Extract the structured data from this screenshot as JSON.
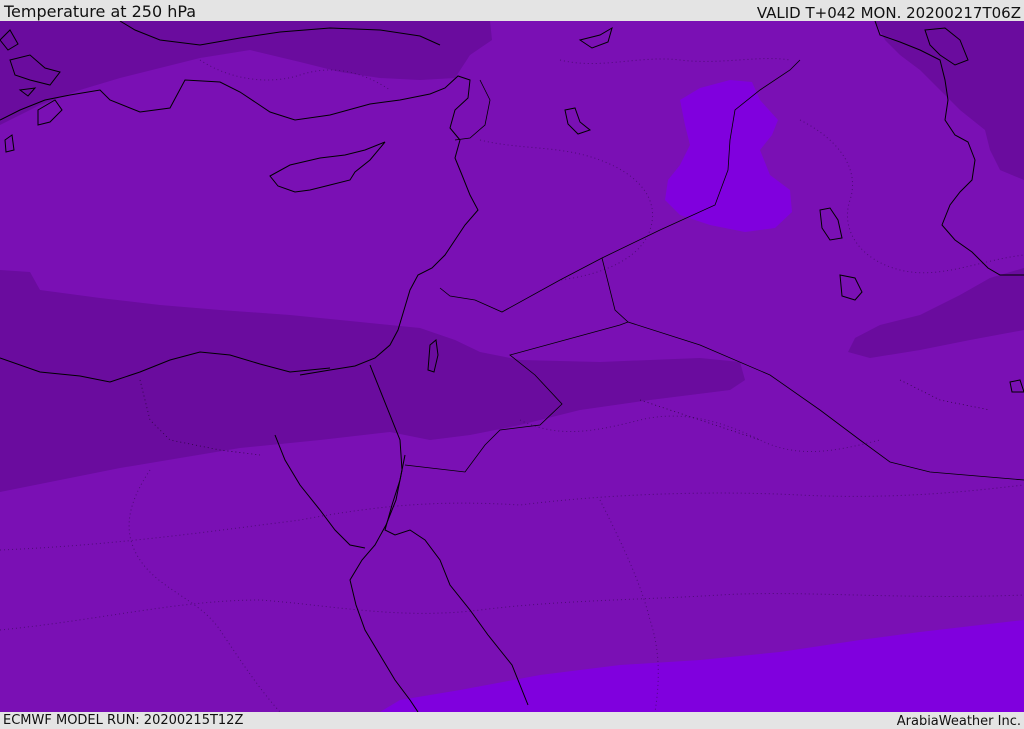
{
  "header": {
    "title": "Temperature at 250 hPa",
    "valid": "VALID T+042 MON. 20200217T06Z"
  },
  "footer": {
    "model_run": "ECMWF MODEL RUN: 20200215T12Z",
    "credit": "ArabiaWeather Inc."
  },
  "colors": {
    "base_field": "#7a10b4",
    "cold_field": "#6a0c9e",
    "warm_field": "#8000de",
    "coastline": "#000000"
  }
}
